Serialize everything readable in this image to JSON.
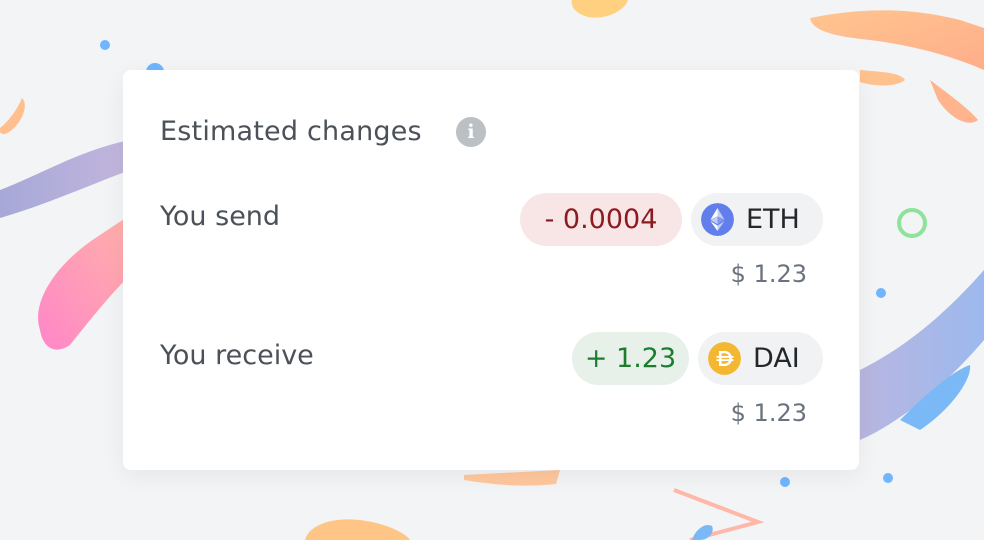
{
  "header": {
    "title": "Estimated changes",
    "info_icon": "info-icon"
  },
  "rows": [
    {
      "label": "You send",
      "amount": "- 0.0004",
      "amount_color": "#8c1b1f",
      "amount_bg": "#f8e5e6",
      "token": {
        "symbol": "ETH",
        "icon": "ethereum-icon",
        "color": "#627eea"
      },
      "fiat": "$ 1.23"
    },
    {
      "label": "You receive",
      "amount": "+ 1.23",
      "amount_color": "#1c7d2f",
      "amount_bg": "#e7f1ea",
      "token": {
        "symbol": "DAI",
        "icon": "dai-icon",
        "color": "#f4b731"
      },
      "fiat": "$ 1.23"
    }
  ],
  "colors": {
    "background": "#f3f4f6",
    "card": "#ffffff",
    "text_primary": "#4b5158",
    "text_secondary": "#6a737d"
  }
}
